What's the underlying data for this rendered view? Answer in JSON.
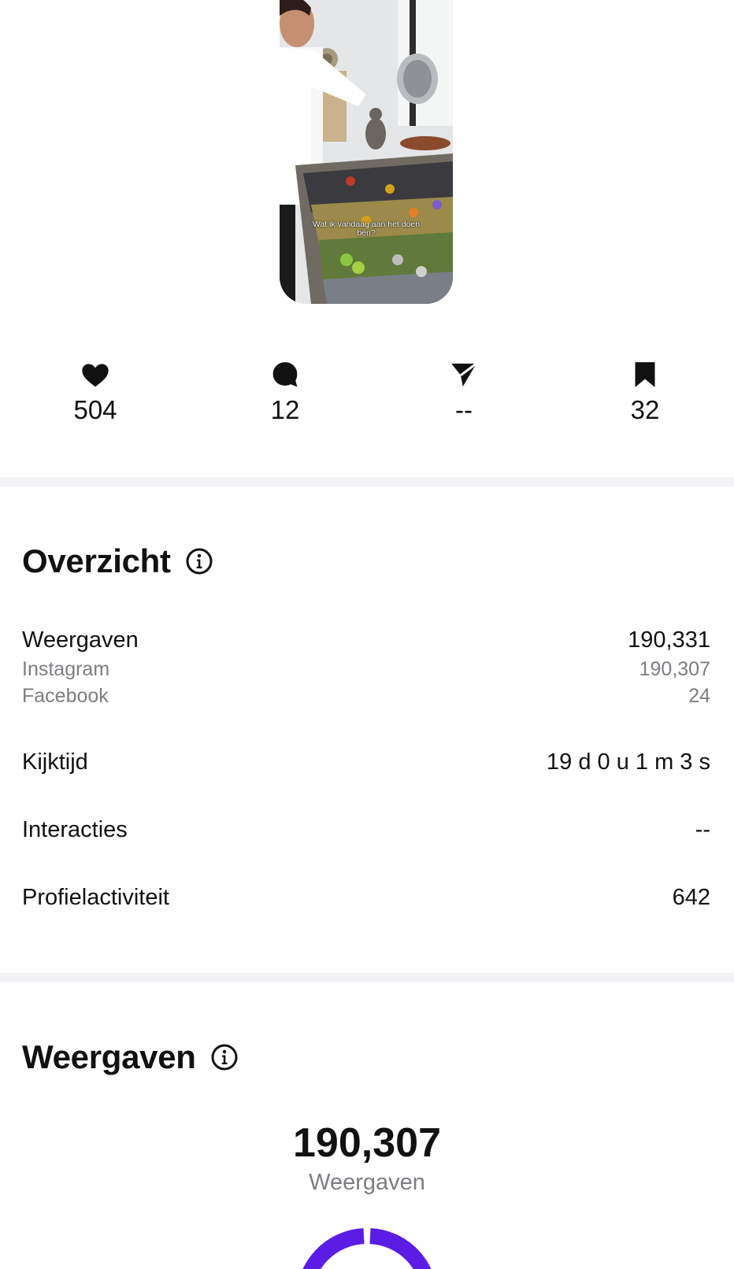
{
  "thumbnail": {
    "caption": "Wat ik vandaag aan het doen ben?"
  },
  "stats": {
    "likes": {
      "icon": "heart-icon",
      "value": "504"
    },
    "comments": {
      "icon": "comment-icon",
      "value": "12"
    },
    "shares": {
      "icon": "paper-plane-icon",
      "value": "--"
    },
    "saves": {
      "icon": "bookmark-icon",
      "value": "32"
    }
  },
  "overview": {
    "title": "Overzicht",
    "views": {
      "label": "Weergaven",
      "value": "190,331"
    },
    "instagram": {
      "label": "Instagram",
      "value": "190,307"
    },
    "facebook": {
      "label": "Facebook",
      "value": "24"
    },
    "watch_time": {
      "label": "Kijktijd",
      "value": "19 d 0 u 1 m 3 s"
    },
    "interactions": {
      "label": "Interacties",
      "value": "--"
    },
    "profile_activity": {
      "label": "Profielactiviteit",
      "value": "642"
    }
  },
  "views_section": {
    "title": "Weergaven",
    "total": "190,307",
    "total_label": "Weergaven"
  },
  "colors": {
    "donut_primary": "#5b1de6",
    "divider": "#f3f3f5",
    "secondary_text": "#7d7d82"
  }
}
